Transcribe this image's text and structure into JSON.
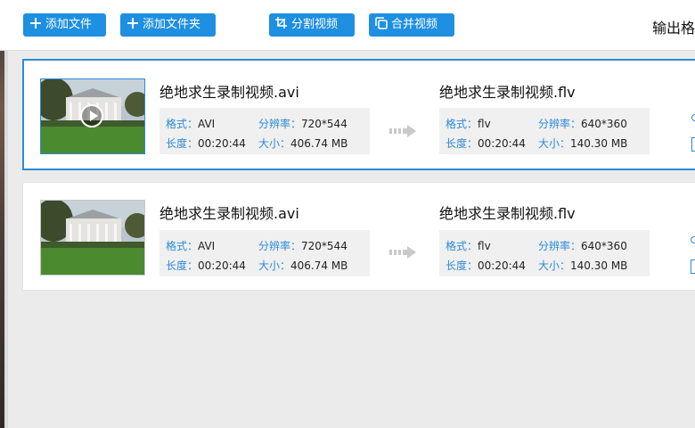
{
  "toolbar": {
    "add_file": "添加文件",
    "add_folder": "添加文件夹",
    "split_video": "分割视频",
    "merge_video": "合并视频",
    "output_format_label": "输出格"
  },
  "colors": {
    "accent": "#1e8fe1",
    "selected_border": "#2b8ad8",
    "label_blue": "#2b8ad8"
  },
  "icons": {
    "add_file": "plus-icon",
    "add_folder": "plus-icon",
    "split_video": "crop-icon",
    "merge_video": "merge-icon",
    "thumbnail_play": "play-icon",
    "convert_arrow": "arrow-right-icon"
  },
  "files": [
    {
      "selected": true,
      "source": {
        "name": "绝地求生录制视频.avi",
        "format_label": "格式：",
        "format": "AVI",
        "resolution_label": "分辨率：",
        "resolution": "720*544",
        "duration_label": "长度：",
        "duration": "00:20:44",
        "size_label": "大小：",
        "size": "406.74 MB"
      },
      "target": {
        "name": "绝地求生录制视频.flv",
        "format_label": "格式：",
        "format": "flv",
        "resolution_label": "分辨率：",
        "resolution": "640*360",
        "duration_label": "长度：",
        "duration": "00:20:44",
        "size_label": "大小：",
        "size": "140.30 MB"
      }
    },
    {
      "selected": false,
      "source": {
        "name": "绝地求生录制视频.avi",
        "format_label": "格式：",
        "format": "AVI",
        "resolution_label": "分辨率：",
        "resolution": "720*544",
        "duration_label": "长度：",
        "duration": "00:20:44",
        "size_label": "大小：",
        "size": "406.74 MB"
      },
      "target": {
        "name": "绝地求生录制视频.flv",
        "format_label": "格式：",
        "format": "flv",
        "resolution_label": "分辨率：",
        "resolution": "640*360",
        "duration_label": "长度：",
        "duration": "00:20:44",
        "size_label": "大小：",
        "size": "140.30 MB"
      }
    }
  ]
}
